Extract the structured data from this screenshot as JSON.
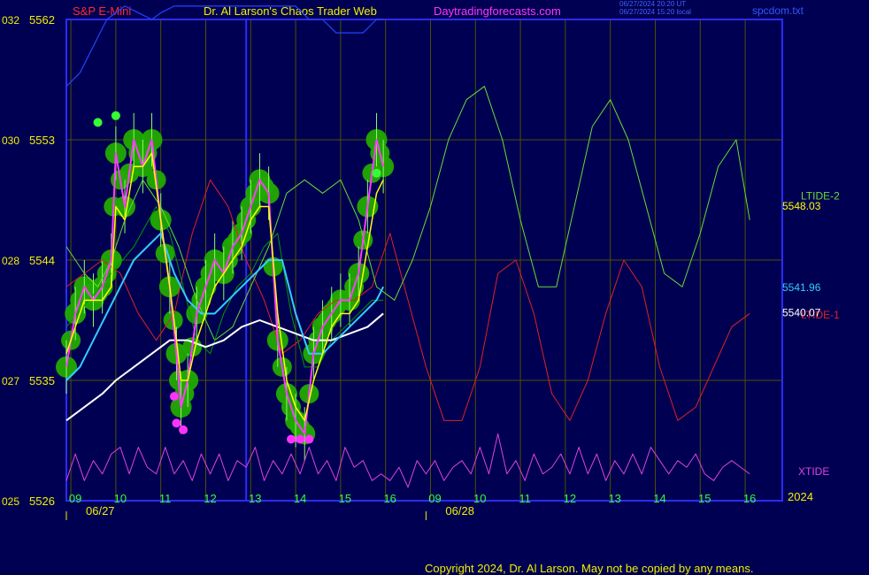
{
  "header": {
    "symbol": "S&P E-Mini",
    "center_title": "Dr. Al Larson's Chaos Trader Web",
    "site": "Daytradingforecasts.com",
    "timestamp_utc": "06/27/2024 20:20 UT",
    "timestamp_local": "06/27/2024 15:20 local",
    "file": "spcdom.txt"
  },
  "footer": {
    "copyright": "Copyright 2024, Dr. Al Larson. May not be copied by any means."
  },
  "colors": {
    "background": "#000052",
    "frame": "#2b2bff",
    "grid": "#505000",
    "price": "#ff3cff",
    "fast_ma": "#ffff00",
    "mid_ma": "#33ccff",
    "slow_ma": "#ffffff",
    "upper_band": "#2244ff",
    "ltide2": "#66dd33",
    "ltide1": "#dd2222",
    "xtide": "#dd44dd",
    "marker_green": "#33ff33",
    "marker_magenta": "#ff33ff",
    "dark_green_line": "#009900"
  },
  "chart_data": {
    "type": "line",
    "title": "S&P E-Mini",
    "ylim": [
      5526,
      5562
    ],
    "y_ticks": [
      {
        "value": 5562,
        "left": "032",
        "right": "5562"
      },
      {
        "value": 5553,
        "left": "030",
        "right": "5553"
      },
      {
        "value": 5544,
        "left": "028",
        "right": "5544"
      },
      {
        "value": 5535,
        "left": "027",
        "right": "5535"
      },
      {
        "value": 5526,
        "left": "025",
        "right": "5526"
      }
    ],
    "x_range": [
      8.9,
      17.0
    ],
    "day_split": 12.9,
    "x_ticks": [
      {
        "x": 9.0,
        "label": "09"
      },
      {
        "x": 10.0,
        "label": "10"
      },
      {
        "x": 11.0,
        "label": "11"
      },
      {
        "x": 12.0,
        "label": "12"
      },
      {
        "x": 13.0,
        "label": "13"
      },
      {
        "x": 14.0,
        "label": "14"
      },
      {
        "x": 15.0,
        "label": "15"
      },
      {
        "x": 16.0,
        "label": "16"
      },
      {
        "x": 17.0,
        "label": "09"
      },
      {
        "x": 18.0,
        "label": "10"
      },
      {
        "x": 19.0,
        "label": "11"
      },
      {
        "x": 20.0,
        "label": "12"
      },
      {
        "x": 21.0,
        "label": "13"
      },
      {
        "x": 22.0,
        "label": "14"
      },
      {
        "x": 23.0,
        "label": "15"
      },
      {
        "x": 24.0,
        "label": "16"
      }
    ],
    "date_labels": [
      {
        "x": 8.9,
        "label": "06/27"
      },
      {
        "x": 16.9,
        "label": "06/28"
      }
    ],
    "year_label": "2024",
    "series": [
      {
        "name": "price",
        "x": [
          8.9,
          9.1,
          9.3,
          9.5,
          9.7,
          9.9,
          10.0,
          10.2,
          10.4,
          10.6,
          10.8,
          11.0,
          11.2,
          11.35,
          11.45,
          11.6,
          11.8,
          12.0,
          12.2,
          12.4,
          12.6,
          12.8,
          13.0,
          13.2,
          13.4,
          13.6,
          13.8,
          14.0,
          14.2,
          14.4,
          14.6,
          14.8,
          15.0,
          15.2,
          15.4,
          15.6,
          15.8,
          15.95
        ],
        "y": [
          5536,
          5540,
          5542,
          5541,
          5542,
          5544,
          5552,
          5548,
          5553,
          5551,
          5553,
          5547,
          5542,
          5537,
          5533,
          5535,
          5540,
          5542,
          5544,
          5543,
          5545,
          5546,
          5548,
          5550,
          5549,
          5538,
          5534,
          5532,
          5531,
          5537,
          5539,
          5540,
          5541,
          5541,
          5543,
          5548,
          5553,
          5551
        ]
      },
      {
        "name": "fast_ma",
        "x": [
          8.9,
          9.1,
          9.3,
          9.5,
          9.7,
          9.9,
          10.0,
          10.2,
          10.4,
          10.6,
          10.8,
          11.0,
          11.2,
          11.35,
          11.45,
          11.6,
          11.8,
          12.0,
          12.2,
          12.4,
          12.6,
          12.8,
          13.0,
          13.2,
          13.4,
          13.6,
          13.8,
          14.0,
          14.2,
          14.4,
          14.6,
          14.8,
          15.0,
          15.2,
          15.4,
          15.6,
          15.8,
          15.95
        ],
        "y": [
          5537,
          5539,
          5541,
          5541,
          5541,
          5542,
          5548,
          5547,
          5551,
          5551,
          5552,
          5547,
          5542,
          5538,
          5535,
          5535,
          5538,
          5540,
          5542,
          5543,
          5544,
          5545,
          5547,
          5548,
          5548,
          5540,
          5535,
          5533,
          5532,
          5535,
          5537,
          5539,
          5540,
          5540,
          5541,
          5545,
          5549,
          5550
        ]
      },
      {
        "name": "mid_ma",
        "x": [
          8.9,
          9.2,
          9.5,
          9.8,
          10.1,
          10.4,
          10.7,
          11.0,
          11.3,
          11.6,
          11.9,
          12.2,
          12.5,
          12.8,
          13.1,
          13.4,
          13.7,
          14.0,
          14.3,
          14.6,
          14.9,
          15.2,
          15.5,
          15.8,
          15.95
        ],
        "y": [
          5535,
          5536,
          5538,
          5540,
          5542,
          5544,
          5545,
          5546,
          5543,
          5541,
          5540,
          5540,
          5541,
          5542,
          5543,
          5544,
          5544,
          5540,
          5537,
          5537,
          5538,
          5539,
          5540,
          5541,
          5542
        ]
      },
      {
        "name": "slow_ma",
        "x": [
          8.9,
          9.3,
          9.7,
          10.0,
          10.4,
          10.8,
          11.2,
          11.6,
          12.0,
          12.4,
          12.8,
          13.2,
          13.6,
          14.0,
          14.4,
          14.8,
          15.2,
          15.6,
          15.95
        ],
        "y": [
          5532,
          5533,
          5534,
          5535,
          5536,
          5537,
          5538,
          5538,
          5537.5,
          5538,
          5539,
          5539.5,
          5539,
          5538.5,
          5538,
          5538,
          5538.5,
          5539,
          5540
        ]
      },
      {
        "name": "upper_band",
        "x": [
          8.9,
          9.2,
          9.5,
          9.8,
          10.0,
          10.2,
          10.5,
          10.8,
          11.0,
          11.3,
          11.6,
          11.9,
          12.2,
          12.5,
          12.8,
          13.1,
          13.4,
          13.7,
          14.0,
          14.3,
          14.6,
          14.9,
          15.2,
          15.5,
          15.8,
          15.95
        ],
        "y": [
          5557,
          5558,
          5560,
          5562,
          5562.5,
          5563,
          5562.5,
          5562,
          5562.5,
          5563,
          5563,
          5563,
          5563,
          5563,
          5563,
          5563,
          5563,
          5563,
          5563,
          5562,
          5562,
          5561,
          5561,
          5561,
          5562,
          5562
        ]
      },
      {
        "name": "LTIDE-2",
        "x": [
          8.9,
          9.3,
          9.6,
          9.9,
          10.2,
          10.6,
          11.0,
          11.4,
          11.8,
          12.2,
          12.6,
          13.0,
          13.4,
          13.8,
          14.2,
          14.6,
          15.0,
          15.4,
          15.8,
          16.2,
          16.6,
          17.0,
          17.4,
          17.8,
          18.2,
          18.6,
          19.0,
          19.4,
          19.8,
          20.2,
          20.6,
          21.0,
          21.4,
          21.8,
          22.2,
          22.6,
          23.0,
          23.4,
          23.8,
          24.1
        ],
        "y": [
          5545,
          5543,
          5542,
          5544,
          5547,
          5550,
          5548,
          5545,
          5541,
          5538,
          5539,
          5542,
          5545,
          5549,
          5550,
          5549,
          5550,
          5547,
          5542,
          5541,
          5544,
          5548,
          5553,
          5556,
          5557,
          5553,
          5547,
          5542,
          5542,
          5548,
          5554,
          5556,
          5553,
          5548,
          5543,
          5542,
          5546,
          5551,
          5553,
          5547
        ]
      },
      {
        "name": "LTIDE-1",
        "x": [
          8.9,
          9.3,
          9.7,
          10.1,
          10.5,
          10.9,
          11.3,
          11.7,
          12.1,
          12.5,
          12.9,
          13.3,
          13.7,
          14.1,
          14.5,
          14.9,
          15.3,
          15.7,
          16.1,
          16.5,
          16.9,
          17.3,
          17.7,
          18.1,
          18.5,
          18.9,
          19.3,
          19.7,
          20.1,
          20.5,
          20.9,
          21.3,
          21.7,
          22.1,
          22.5,
          22.9,
          23.3,
          23.7,
          24.1
        ],
        "y": [
          5542,
          5543,
          5544,
          5543,
          5540,
          5538,
          5540,
          5546,
          5550,
          5548,
          5544,
          5541,
          5537,
          5538,
          5540,
          5541,
          5541,
          5542,
          5546,
          5541,
          5536,
          5532,
          5532,
          5536,
          5543,
          5544,
          5540,
          5534,
          5532,
          5535,
          5540,
          5544,
          5542,
          5536,
          5532,
          5533,
          5536,
          5539,
          5540
        ]
      },
      {
        "name": "XTIDE",
        "x": [
          8.9,
          9.1,
          9.3,
          9.5,
          9.7,
          9.9,
          10.1,
          10.3,
          10.5,
          10.7,
          10.9,
          11.1,
          11.3,
          11.5,
          11.7,
          11.9,
          12.1,
          12.3,
          12.5,
          12.7,
          12.9,
          13.1,
          13.3,
          13.5,
          13.7,
          13.9,
          14.1,
          14.3,
          14.5,
          14.7,
          14.9,
          15.1,
          15.3,
          15.5,
          15.7,
          15.9,
          16.1,
          16.3,
          16.5,
          16.7,
          16.9,
          17.1,
          17.3,
          17.5,
          17.7,
          17.9,
          18.1,
          18.3,
          18.5,
          18.7,
          18.9,
          19.1,
          19.3,
          19.5,
          19.7,
          19.9,
          20.1,
          20.3,
          20.5,
          20.7,
          20.9,
          21.1,
          21.3,
          21.5,
          21.7,
          21.9,
          22.1,
          22.3,
          22.5,
          22.7,
          22.9,
          23.1,
          23.3,
          23.5,
          23.7,
          23.9,
          24.1
        ],
        "y": [
          5527.5,
          5529.5,
          5527.5,
          5529,
          5528,
          5529.5,
          5530,
          5528,
          5530,
          5528.5,
          5528,
          5530,
          5528,
          5529,
          5527.5,
          5529.5,
          5528,
          5529.5,
          5527.5,
          5529,
          5528.5,
          5530,
          5527.5,
          5529,
          5528,
          5529.5,
          5528,
          5530,
          5528,
          5529,
          5527.5,
          5530,
          5528.5,
          5529,
          5527.5,
          5528,
          5527.5,
          5528.5,
          5527,
          5529,
          5528,
          5529,
          5527.5,
          5528.5,
          5529,
          5528,
          5530,
          5528,
          5531,
          5528,
          5529,
          5527.5,
          5529.5,
          5528,
          5528.5,
          5529.5,
          5528,
          5530,
          5528,
          5529.5,
          5527.5,
          5529,
          5528,
          5529.5,
          5528,
          5530,
          5529,
          5528,
          5529,
          5528.5,
          5529.5,
          5528,
          5527.5,
          5528.5,
          5529,
          5528.5,
          5528
        ]
      },
      {
        "name": "dark_green_proxy",
        "x": [
          8.9,
          9.4,
          9.9,
          10.4,
          10.9,
          11.2,
          11.5,
          11.8,
          12.1,
          12.4,
          12.7,
          13.0,
          13.3,
          13.6,
          13.9,
          14.2,
          14.5,
          14.8,
          15.1,
          15.4,
          15.7,
          15.95
        ],
        "y": [
          5539,
          5541,
          5543,
          5545,
          5548,
          5546,
          5542,
          5538,
          5537,
          5540,
          5542,
          5543,
          5545,
          5546,
          5540,
          5536,
          5536,
          5538,
          5539,
          5540,
          5541,
          5541
        ]
      }
    ],
    "right_labels": [
      {
        "text": "LTIDE-2",
        "y": 5548.8,
        "color_key": "ltide2"
      },
      {
        "text": "5548.03",
        "y": 5548.03,
        "color_key": "fast_ma"
      },
      {
        "text": "5541.96",
        "y": 5541.96,
        "color_key": "mid_ma"
      },
      {
        "text": "LTIDE-1",
        "y": 5539.9,
        "color_key": "ltide1"
      },
      {
        "text": "5540.07",
        "y": 5540.07,
        "color_key": "slow_ma"
      },
      {
        "text": "XTIDE",
        "y": 5528.2,
        "color_key": "xtide"
      }
    ],
    "green_dots": [
      [
        9.6,
        5554.3
      ],
      [
        10.0,
        5554.8
      ],
      [
        15.8,
        5550.5
      ]
    ],
    "magenta_dots": [
      [
        11.3,
        5533.8
      ],
      [
        11.35,
        5531.8
      ],
      [
        11.5,
        5531.3
      ],
      [
        13.9,
        5530.6
      ],
      [
        14.1,
        5530.6
      ],
      [
        14.3,
        5530.6
      ]
    ]
  }
}
